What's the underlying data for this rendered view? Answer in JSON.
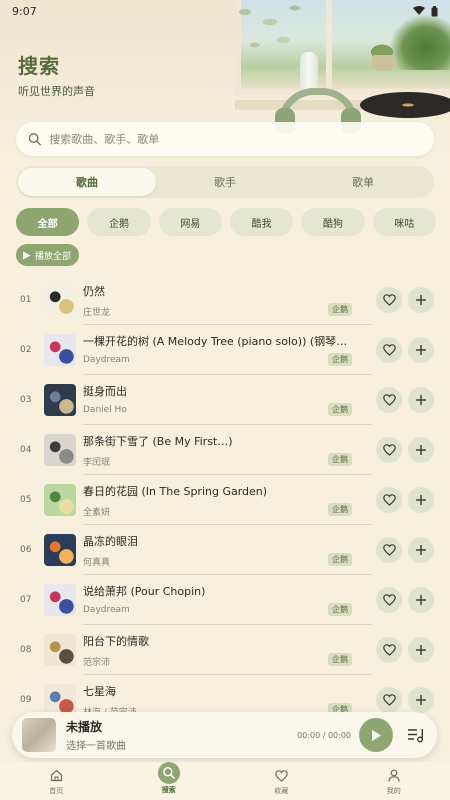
{
  "status_bar": {
    "time": "9:07"
  },
  "header": {
    "title": "搜索",
    "subtitle": "听见世界的声音"
  },
  "search": {
    "placeholder": "搜索歌曲、歌手、歌单",
    "value": ""
  },
  "type_tabs": [
    {
      "label": "歌曲",
      "active": true
    },
    {
      "label": "歌手",
      "active": false
    },
    {
      "label": "歌单",
      "active": false
    }
  ],
  "sources": [
    {
      "label": "全部",
      "active": true
    },
    {
      "label": "企鹅",
      "active": false
    },
    {
      "label": "网易",
      "active": false
    },
    {
      "label": "酷我",
      "active": false
    },
    {
      "label": "酷狗",
      "active": false
    },
    {
      "label": "咪咕",
      "active": false
    }
  ],
  "play_all_label": "播放全部",
  "songs": [
    {
      "index": "01",
      "title": "仍然",
      "artist": "庄世龙",
      "source": "企鹅",
      "cover": [
        "#f3efe3",
        "#2a2a2a",
        "#d9c27a"
      ]
    },
    {
      "index": "02",
      "title": "一棵开花的树 (A Melody Tree (piano solo)) (钢琴独奏版)",
      "artist": "Daydream",
      "source": "企鹅",
      "cover": [
        "#e9e6ef",
        "#c9365c",
        "#3a4fa0"
      ]
    },
    {
      "index": "03",
      "title": "挺身而出",
      "artist": "Daniel Ho",
      "source": "企鹅",
      "cover": [
        "#2f3a4c",
        "#6d7f9a",
        "#c8b98f"
      ]
    },
    {
      "index": "04",
      "title": "那条街下雪了 (Be My First…)",
      "artist": "李闰珉",
      "source": "企鹅",
      "cover": [
        "#d9d6d0",
        "#3c3c3c",
        "#8a8a86"
      ]
    },
    {
      "index": "05",
      "title": "春日的花园 (In The Spring Garden)",
      "artist": "全素妍",
      "source": "企鹅",
      "cover": [
        "#b9d9a0",
        "#4f8a3a",
        "#e8e0a0"
      ]
    },
    {
      "index": "06",
      "title": "晶冻的眼泪",
      "artist": "何真真",
      "source": "企鹅",
      "cover": [
        "#2b3b5a",
        "#e07a2a",
        "#f2b35a"
      ]
    },
    {
      "index": "07",
      "title": "说给萧邦 (Pour Chopin)",
      "artist": "Daydream",
      "source": "企鹅",
      "cover": [
        "#e9e6ef",
        "#c9365c",
        "#3a4fa0"
      ]
    },
    {
      "index": "08",
      "title": "阳台下的情歌",
      "artist": "范宗沛",
      "source": "企鹅",
      "cover": [
        "#efe7d2",
        "#b8934e",
        "#5a5040"
      ]
    },
    {
      "index": "09",
      "title": "七星海",
      "artist": "林海 / 范宗沛",
      "source": "企鹅",
      "cover": [
        "#f0e9da",
        "#5d7fb0",
        "#c85a4a"
      ]
    }
  ],
  "mini_player": {
    "title": "未播放",
    "subtitle": "选择一首歌曲",
    "time": "00:00 / 00:00"
  },
  "nav": [
    {
      "label": "首页",
      "icon": "home-icon",
      "active": false
    },
    {
      "label": "搜索",
      "icon": "search-icon",
      "active": true
    },
    {
      "label": "收藏",
      "icon": "heart-icon",
      "active": false
    },
    {
      "label": "我的",
      "icon": "user-icon",
      "active": false
    }
  ],
  "colors": {
    "accent": "#8ea770",
    "background": "#f6f0dd",
    "chip": "#e1e4cd"
  }
}
